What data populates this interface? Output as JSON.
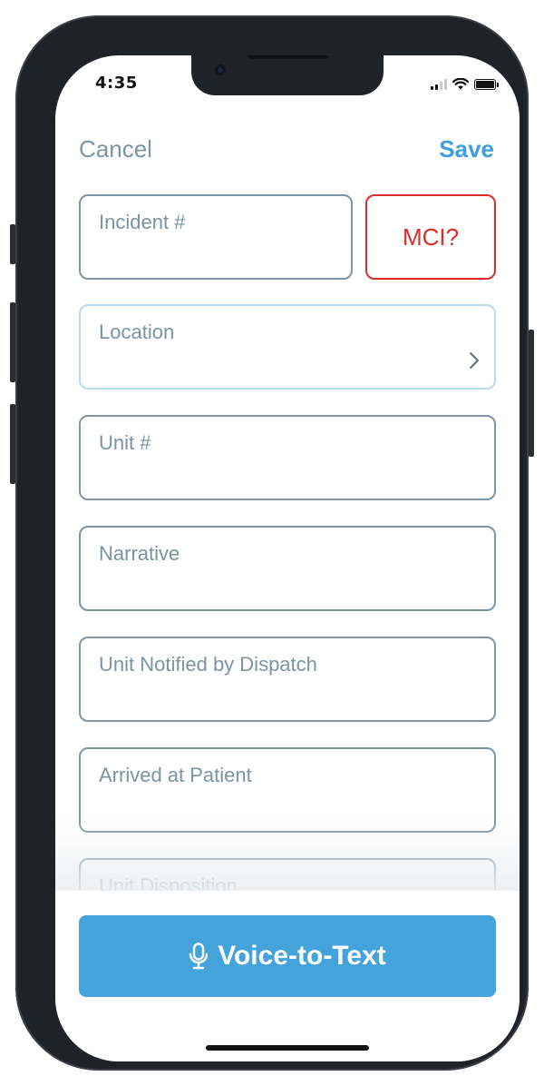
{
  "status_bar": {
    "time": "4:35"
  },
  "nav": {
    "cancel_label": "Cancel",
    "save_label": "Save"
  },
  "form": {
    "incident_label": "Incident #",
    "mci_label": "MCI?",
    "location_label": "Location",
    "unit_label": "Unit #",
    "narrative_label": "Narrative",
    "unit_notified_label": "Unit Notified by Dispatch",
    "arrived_label": "Arrived at Patient",
    "disposition_label": "Unit Disposition"
  },
  "footer": {
    "voice_label": "Voice-to-Text"
  },
  "colors": {
    "accent": "#45a3db",
    "save": "#3d9fdd",
    "cancel": "#7a97a8",
    "field_border": "#7b96a8",
    "mci_red": "#e02b2b",
    "focused_border": "#b6dbf2"
  },
  "icons": {
    "microphone": "microphone-icon",
    "chevron": "chevron-right-icon",
    "wifi": "wifi-icon",
    "signal": "cellular-signal-icon",
    "battery": "battery-icon"
  }
}
